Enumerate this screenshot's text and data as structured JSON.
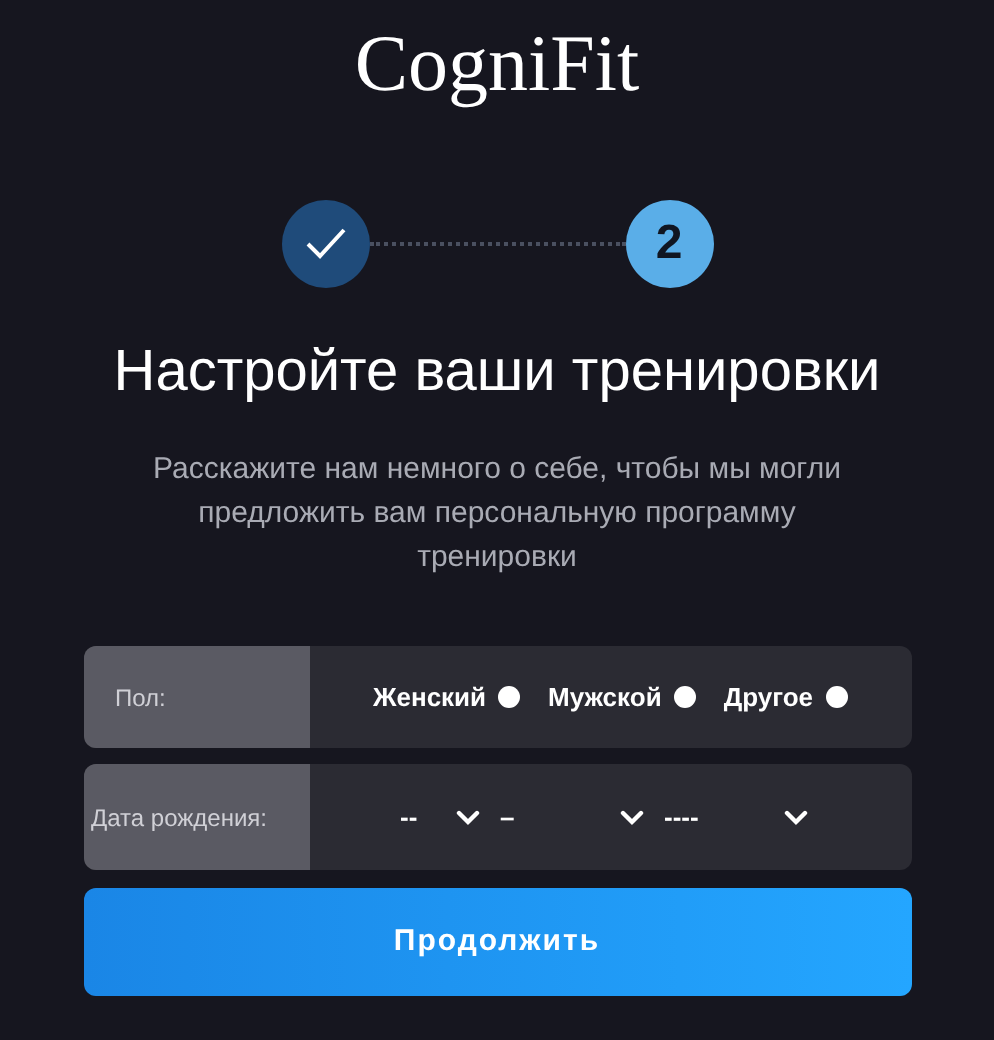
{
  "logo": {
    "text": "CogniFit"
  },
  "steps": [
    {
      "kind": "done"
    },
    {
      "kind": "current",
      "label": "2"
    }
  ],
  "title": "Настройте ваши тренировки",
  "subtitle": "Расскажите нам немного о себе, чтобы мы могли предложить вам персональную программу тренировки",
  "gender": {
    "label": "Пол:",
    "options": [
      {
        "label": "Женский",
        "selected": false
      },
      {
        "label": "Мужской",
        "selected": false
      },
      {
        "label": "Другое",
        "selected": false
      }
    ]
  },
  "birthdate": {
    "label": "Дата рождения:",
    "selects": [
      {
        "value": "--"
      },
      {
        "value": "–"
      },
      {
        "value": "----"
      }
    ]
  },
  "continue_button": "Продолжить"
}
